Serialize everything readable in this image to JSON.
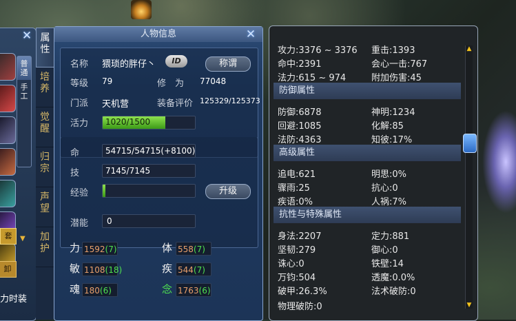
{
  "left_panel": {
    "close_glyph": "✕",
    "mode_tabs": [
      "普通",
      "手工"
    ],
    "seal_button": "卸",
    "slot_button": "套",
    "force_text": "力时装"
  },
  "vertical_tabs": [
    "属性",
    "培养",
    "觉醒",
    "归宗",
    "声望",
    "加护"
  ],
  "main": {
    "title": "人物信息",
    "close_glyph": "✕",
    "name_label": "名称",
    "name_value": "猥琐的胖仔丶",
    "id_badge": "ID",
    "title_button": "称谓",
    "level_label": "等级",
    "level_value": "79",
    "cultivation_label": "修　为",
    "cultivation_value": "77048",
    "sect_label": "门派",
    "sect_value": "天机营",
    "equip_label": "装备评价",
    "equip_value": "125329/125373",
    "vitality_label": "活力",
    "vitality_value": "1020/1500",
    "vitality_fraction": 0.68,
    "life_label": "命",
    "life_value": "54715/54715(+8100)",
    "skill_label": "技",
    "skill_value": "7145/7145",
    "exp_label": "经验",
    "exp_fraction": 0.02,
    "upgrade_button": "升级",
    "potential_label": "潜能",
    "potential_value": "0",
    "attributes": [
      {
        "label": "力",
        "base": "1592",
        "bonus": "(7)"
      },
      {
        "label": "体",
        "base": "558",
        "bonus": "(7)"
      },
      {
        "label": "敏",
        "base": "1108",
        "bonus": "(18)"
      },
      {
        "label": "疾",
        "base": "544",
        "bonus": "(7)"
      },
      {
        "label": "魂",
        "base": "180",
        "bonus": "(6)"
      },
      {
        "label": "念",
        "base": "1763",
        "bonus": "(6)"
      }
    ]
  },
  "right": {
    "top_rows": [
      [
        "攻力:3376 ~ 3376",
        "重击:1393"
      ],
      [
        "命中:2391",
        "会心一击:767"
      ],
      [
        "法力:615 ~ 974",
        "附加伤害:45"
      ]
    ],
    "defense_header": "防御属性",
    "defense_rows": [
      [
        "防御:6878",
        "神明:1234"
      ],
      [
        "回避:1085",
        "化解:85"
      ],
      [
        "法防:4363",
        "知彼:17%"
      ]
    ],
    "advanced_header": "高级属性",
    "advanced_rows": [
      [
        "追电:621",
        "明思:0%"
      ],
      [
        "骤雨:25",
        "抗心:0"
      ],
      [
        "疾语:0%",
        "人祸:7%"
      ]
    ],
    "resist_header": "抗性与特殊属性",
    "resist_rows": [
      [
        "身法:2207",
        "定力:881"
      ],
      [
        "坚韧:279",
        "御心:0"
      ],
      [
        "诛心:0",
        "铁壁:14"
      ],
      [
        "万钧:504",
        "透魔:0.0%"
      ],
      [
        "破甲:26.3%",
        "法术破防:0"
      ]
    ],
    "cut_row": "物理破防:0"
  }
}
